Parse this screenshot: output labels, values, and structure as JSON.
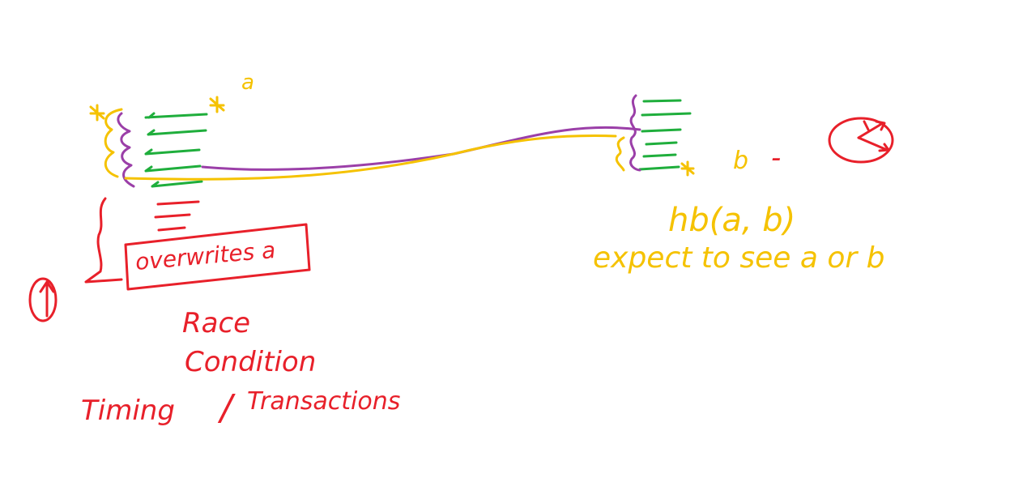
{
  "colors": {
    "red": "#e8202a",
    "yellow": "#f5c200",
    "green": "#1fae3c",
    "purple": "#9b3fa8"
  },
  "labels": {
    "a_label": "a",
    "b_label": "b",
    "b_dash": "-",
    "happens_before": "hb(a, b)",
    "expectation": "expect to see a or b",
    "overwrites": "overwrites a",
    "race": "Race",
    "condition": "Condition",
    "timing": "Timing",
    "slash": "/",
    "transactions": "Transactions"
  },
  "icons": [
    "clock-icon",
    "star-icon",
    "up-arrow-icon"
  ]
}
